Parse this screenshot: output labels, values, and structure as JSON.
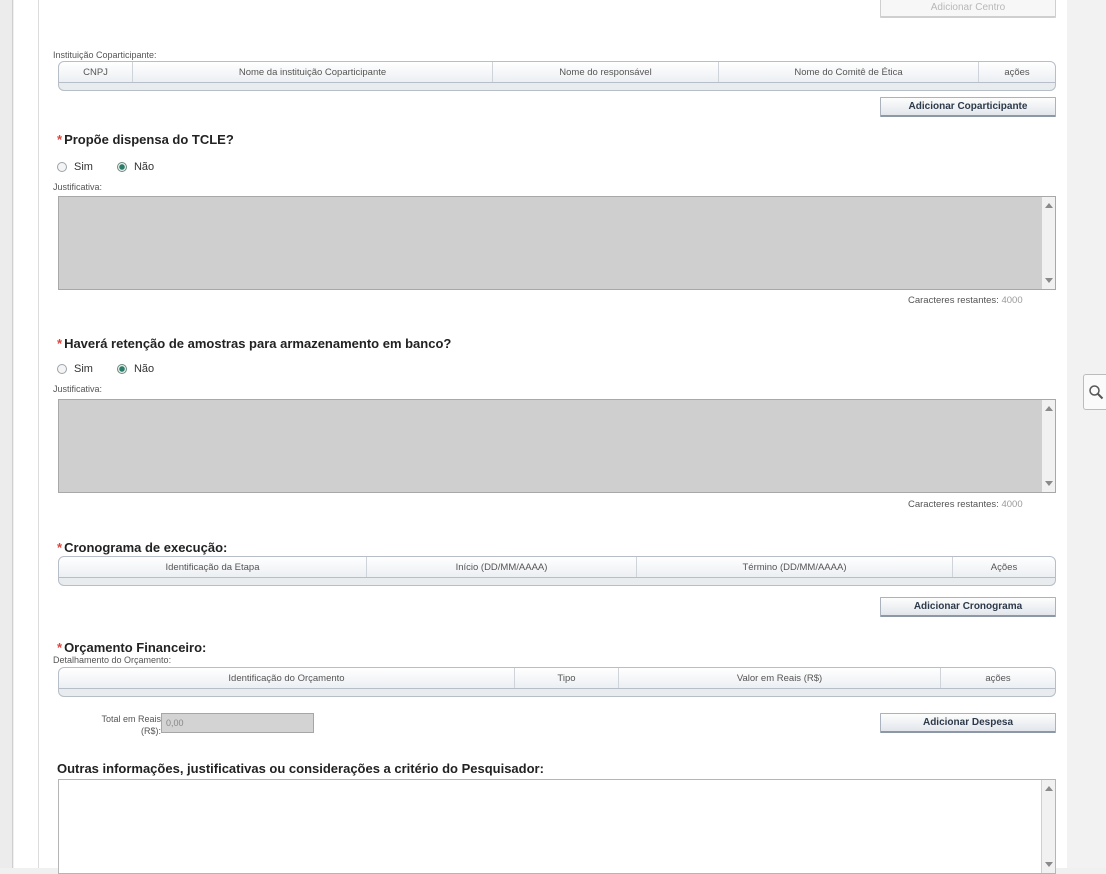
{
  "top_button": "Adicionar Centro",
  "coparticipantes": {
    "label": "Instituição Coparticipante:",
    "columns": [
      "CNPJ",
      "Nome da instituição Coparticipante",
      "Nome do responsável",
      "Nome do Comitê de Ética",
      "ações"
    ],
    "add_button": "Adicionar Coparticipante"
  },
  "tcle": {
    "question": "Propõe dispensa do TCLE?",
    "options": [
      "Sim",
      "Não"
    ],
    "selected": "Não",
    "justificativa_label": "Justificativa:",
    "counter_label": "Caracteres restantes:",
    "counter_value": "4000"
  },
  "amostras": {
    "question": "Haverá retenção de amostras para armazenamento em banco?",
    "options": [
      "Sim",
      "Não"
    ],
    "selected": "Não",
    "justificativa_label": "Justificativa:",
    "counter_label": "Caracteres restantes:",
    "counter_value": "4000"
  },
  "cronograma": {
    "title": "Cronograma de execução:",
    "columns": [
      "Identificação da Etapa",
      "Início (DD/MM/AAAA)",
      "Término (DD/MM/AAAA)",
      "Ações"
    ],
    "add_button": "Adicionar Cronograma"
  },
  "orcamento": {
    "title": "Orçamento Financeiro:",
    "detalhamento_label": "Detalhamento do Orçamento:",
    "columns": [
      "Identificação do Orçamento",
      "Tipo",
      "Valor em Reais (R$)",
      "ações"
    ],
    "total_label_line1": "Total em Reais",
    "total_label_line2": "(R$):",
    "total_value": "0,00",
    "add_button": "Adicionar Despesa"
  },
  "outras": {
    "title": "Outras informações, justificativas ou considerações a critério do Pesquisador:"
  }
}
